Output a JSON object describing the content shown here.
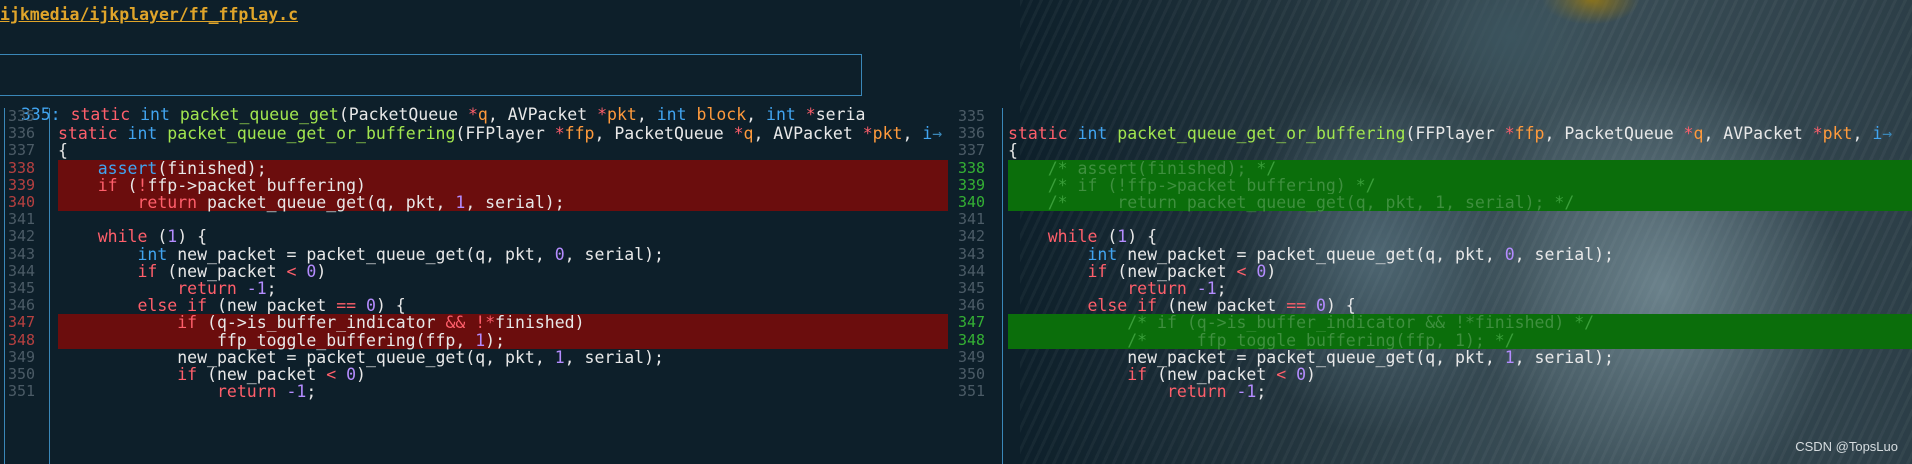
{
  "file_path": "ijkmedia/ijkplayer/ff_ffplay.c",
  "signature_line": {
    "number": "335:",
    "tokens": [
      {
        "t": " ",
        "c": ""
      },
      {
        "t": "static",
        "c": "kw"
      },
      {
        "t": " ",
        "c": ""
      },
      {
        "t": "int",
        "c": "ty"
      },
      {
        "t": " ",
        "c": ""
      },
      {
        "t": "packet_queue_get",
        "c": "fn"
      },
      {
        "t": "(PacketQueue ",
        "c": ""
      },
      {
        "t": "*",
        "c": "op"
      },
      {
        "t": "q",
        "c": "pm"
      },
      {
        "t": ", AVPacket ",
        "c": ""
      },
      {
        "t": "*",
        "c": "op"
      },
      {
        "t": "pkt",
        "c": "pm"
      },
      {
        "t": ", ",
        "c": ""
      },
      {
        "t": "int",
        "c": "ty"
      },
      {
        "t": " ",
        "c": ""
      },
      {
        "t": "block",
        "c": "pm"
      },
      {
        "t": ", ",
        "c": ""
      },
      {
        "t": "int",
        "c": "ty"
      },
      {
        "t": " ",
        "c": ""
      },
      {
        "t": "*",
        "c": "op"
      },
      {
        "t": "seria",
        "c": ""
      }
    ]
  },
  "left_lines": [
    {
      "n": "335",
      "mark": "",
      "tokens": []
    },
    {
      "n": "336",
      "mark": "",
      "tokens": [
        {
          "t": "static",
          "c": "kw"
        },
        {
          "t": " ",
          "c": ""
        },
        {
          "t": "int",
          "c": "ty"
        },
        {
          "t": " ",
          "c": ""
        },
        {
          "t": "packet_queue_get_or_buffering",
          "c": "fn"
        },
        {
          "t": "(FFPlayer ",
          "c": ""
        },
        {
          "t": "*",
          "c": "op"
        },
        {
          "t": "ffp",
          "c": "pm"
        },
        {
          "t": ", PacketQueue ",
          "c": ""
        },
        {
          "t": "*",
          "c": "op"
        },
        {
          "t": "q",
          "c": "pm"
        },
        {
          "t": ", AVPacket ",
          "c": ""
        },
        {
          "t": "*",
          "c": "op"
        },
        {
          "t": "pkt",
          "c": "pm"
        },
        {
          "t": ", ",
          "c": ""
        },
        {
          "t": "i",
          "c": "ty"
        },
        {
          "t": "→",
          "c": "trunc"
        }
      ]
    },
    {
      "n": "337",
      "mark": "",
      "tokens": [
        {
          "t": "{",
          "c": ""
        }
      ]
    },
    {
      "n": "338",
      "mark": "del",
      "tokens": [
        {
          "t": "    ",
          "c": ""
        },
        {
          "t": "assert",
          "c": "ty"
        },
        {
          "t": "(finished);",
          "c": ""
        }
      ]
    },
    {
      "n": "339",
      "mark": "del",
      "tokens": [
        {
          "t": "    ",
          "c": ""
        },
        {
          "t": "if",
          "c": "kw"
        },
        {
          "t": " (",
          "c": ""
        },
        {
          "t": "!",
          "c": "op"
        },
        {
          "t": "ffp->packet_buffering)",
          "c": ""
        }
      ]
    },
    {
      "n": "340",
      "mark": "del",
      "tokens": [
        {
          "t": "        ",
          "c": ""
        },
        {
          "t": "return",
          "c": "kw"
        },
        {
          "t": " packet_queue_get(q, pkt, ",
          "c": ""
        },
        {
          "t": "1",
          "c": "num"
        },
        {
          "t": ", serial);",
          "c": ""
        }
      ]
    },
    {
      "n": "341",
      "mark": "",
      "tokens": []
    },
    {
      "n": "342",
      "mark": "",
      "tokens": [
        {
          "t": "    ",
          "c": ""
        },
        {
          "t": "while",
          "c": "kw"
        },
        {
          "t": " (",
          "c": ""
        },
        {
          "t": "1",
          "c": "num"
        },
        {
          "t": ") {",
          "c": ""
        }
      ]
    },
    {
      "n": "343",
      "mark": "",
      "tokens": [
        {
          "t": "        ",
          "c": ""
        },
        {
          "t": "int",
          "c": "ty"
        },
        {
          "t": " new_packet = packet_queue_get(q, pkt, ",
          "c": ""
        },
        {
          "t": "0",
          "c": "num"
        },
        {
          "t": ", serial);",
          "c": ""
        }
      ]
    },
    {
      "n": "344",
      "mark": "",
      "tokens": [
        {
          "t": "        ",
          "c": ""
        },
        {
          "t": "if",
          "c": "kw"
        },
        {
          "t": " (new_packet ",
          "c": ""
        },
        {
          "t": "<",
          "c": "op"
        },
        {
          "t": " ",
          "c": ""
        },
        {
          "t": "0",
          "c": "num"
        },
        {
          "t": ")",
          "c": ""
        }
      ]
    },
    {
      "n": "345",
      "mark": "",
      "tokens": [
        {
          "t": "            ",
          "c": ""
        },
        {
          "t": "return",
          "c": "kw"
        },
        {
          "t": " ",
          "c": ""
        },
        {
          "t": "-1",
          "c": "num"
        },
        {
          "t": ";",
          "c": ""
        }
      ]
    },
    {
      "n": "346",
      "mark": "",
      "tokens": [
        {
          "t": "        ",
          "c": ""
        },
        {
          "t": "else",
          "c": "kw"
        },
        {
          "t": " ",
          "c": ""
        },
        {
          "t": "if",
          "c": "kw"
        },
        {
          "t": " (new_packet ",
          "c": ""
        },
        {
          "t": "==",
          "c": "op"
        },
        {
          "t": " ",
          "c": ""
        },
        {
          "t": "0",
          "c": "num"
        },
        {
          "t": ") {",
          "c": ""
        }
      ]
    },
    {
      "n": "347",
      "mark": "del",
      "tokens": [
        {
          "t": "            ",
          "c": ""
        },
        {
          "t": "if",
          "c": "kw"
        },
        {
          "t": " (q->is_buffer_indicator ",
          "c": ""
        },
        {
          "t": "&&",
          "c": "op"
        },
        {
          "t": " ",
          "c": ""
        },
        {
          "t": "!*",
          "c": "op"
        },
        {
          "t": "finished)",
          "c": ""
        }
      ]
    },
    {
      "n": "348",
      "mark": "del",
      "tokens": [
        {
          "t": "                ffp_toggle_buffering(ffp, ",
          "c": ""
        },
        {
          "t": "1",
          "c": "num"
        },
        {
          "t": ");",
          "c": ""
        }
      ]
    },
    {
      "n": "349",
      "mark": "",
      "tokens": [
        {
          "t": "            new_packet = packet_queue_get(q, pkt, ",
          "c": ""
        },
        {
          "t": "1",
          "c": "num"
        },
        {
          "t": ", serial);",
          "c": ""
        }
      ]
    },
    {
      "n": "350",
      "mark": "",
      "tokens": [
        {
          "t": "            ",
          "c": ""
        },
        {
          "t": "if",
          "c": "kw"
        },
        {
          "t": " (new_packet ",
          "c": ""
        },
        {
          "t": "<",
          "c": "op"
        },
        {
          "t": " ",
          "c": ""
        },
        {
          "t": "0",
          "c": "num"
        },
        {
          "t": ")",
          "c": ""
        }
      ]
    },
    {
      "n": "351",
      "mark": "",
      "tokens": [
        {
          "t": "                ",
          "c": ""
        },
        {
          "t": "return",
          "c": "kw"
        },
        {
          "t": " ",
          "c": ""
        },
        {
          "t": "-1",
          "c": "num"
        },
        {
          "t": ";",
          "c": ""
        }
      ]
    }
  ],
  "right_lines": [
    {
      "n": "335",
      "mark": "",
      "tokens": []
    },
    {
      "n": "336",
      "mark": "",
      "tokens": [
        {
          "t": "static",
          "c": "kw"
        },
        {
          "t": " ",
          "c": ""
        },
        {
          "t": "int",
          "c": "ty"
        },
        {
          "t": " ",
          "c": ""
        },
        {
          "t": "packet_queue_get_or_buffering",
          "c": "fn"
        },
        {
          "t": "(FFPlayer ",
          "c": ""
        },
        {
          "t": "*",
          "c": "op"
        },
        {
          "t": "ffp",
          "c": "pm"
        },
        {
          "t": ", PacketQueue ",
          "c": ""
        },
        {
          "t": "*",
          "c": "op"
        },
        {
          "t": "q",
          "c": "pm"
        },
        {
          "t": ", AVPacket ",
          "c": ""
        },
        {
          "t": "*",
          "c": "op"
        },
        {
          "t": "pkt",
          "c": "pm"
        },
        {
          "t": ", ",
          "c": ""
        },
        {
          "t": "i",
          "c": "ty"
        },
        {
          "t": "→",
          "c": "trunc"
        }
      ]
    },
    {
      "n": "337",
      "mark": "",
      "tokens": [
        {
          "t": "{",
          "c": ""
        }
      ]
    },
    {
      "n": "338",
      "mark": "add",
      "tokens": [
        {
          "t": "    ",
          "c": ""
        },
        {
          "t": "/*",
          "c": "cm"
        },
        {
          "t": " assert(finished); ",
          "c": "cm-txt"
        },
        {
          "t": "*/",
          "c": "cm"
        }
      ]
    },
    {
      "n": "339",
      "mark": "add",
      "tokens": [
        {
          "t": "    ",
          "c": ""
        },
        {
          "t": "/*",
          "c": "cm"
        },
        {
          "t": " if (!ffp->packet_buffering) ",
          "c": "cm-txt"
        },
        {
          "t": "*/",
          "c": "cm"
        }
      ]
    },
    {
      "n": "340",
      "mark": "add",
      "tokens": [
        {
          "t": "    ",
          "c": ""
        },
        {
          "t": "/*",
          "c": "cm"
        },
        {
          "t": "     return packet_queue_get(q, pkt, 1, serial); ",
          "c": "cm-txt"
        },
        {
          "t": "*/",
          "c": "cm"
        }
      ]
    },
    {
      "n": "341",
      "mark": "",
      "tokens": []
    },
    {
      "n": "342",
      "mark": "",
      "tokens": [
        {
          "t": "    ",
          "c": ""
        },
        {
          "t": "while",
          "c": "kw"
        },
        {
          "t": " (",
          "c": ""
        },
        {
          "t": "1",
          "c": "num"
        },
        {
          "t": ") {",
          "c": ""
        }
      ]
    },
    {
      "n": "343",
      "mark": "",
      "tokens": [
        {
          "t": "        ",
          "c": ""
        },
        {
          "t": "int",
          "c": "ty"
        },
        {
          "t": " new_packet = packet_queue_get(q, pkt, ",
          "c": ""
        },
        {
          "t": "0",
          "c": "num"
        },
        {
          "t": ", serial);",
          "c": ""
        }
      ]
    },
    {
      "n": "344",
      "mark": "",
      "tokens": [
        {
          "t": "        ",
          "c": ""
        },
        {
          "t": "if",
          "c": "kw"
        },
        {
          "t": " (new_packet ",
          "c": ""
        },
        {
          "t": "<",
          "c": "op"
        },
        {
          "t": " ",
          "c": ""
        },
        {
          "t": "0",
          "c": "num"
        },
        {
          "t": ")",
          "c": ""
        }
      ]
    },
    {
      "n": "345",
      "mark": "",
      "tokens": [
        {
          "t": "            ",
          "c": ""
        },
        {
          "t": "return",
          "c": "kw"
        },
        {
          "t": " ",
          "c": ""
        },
        {
          "t": "-1",
          "c": "num"
        },
        {
          "t": ";",
          "c": ""
        }
      ]
    },
    {
      "n": "346",
      "mark": "",
      "tokens": [
        {
          "t": "        ",
          "c": ""
        },
        {
          "t": "else",
          "c": "kw"
        },
        {
          "t": " ",
          "c": ""
        },
        {
          "t": "if",
          "c": "kw"
        },
        {
          "t": " (new_packet ",
          "c": ""
        },
        {
          "t": "==",
          "c": "op"
        },
        {
          "t": " ",
          "c": ""
        },
        {
          "t": "0",
          "c": "num"
        },
        {
          "t": ") {",
          "c": ""
        }
      ]
    },
    {
      "n": "347",
      "mark": "add",
      "tokens": [
        {
          "t": "            ",
          "c": ""
        },
        {
          "t": "/*",
          "c": "cm"
        },
        {
          "t": " if (q->is_buffer_indicator && !*finished) ",
          "c": "cm-txt"
        },
        {
          "t": "*/",
          "c": "cm"
        }
      ]
    },
    {
      "n": "348",
      "mark": "add",
      "tokens": [
        {
          "t": "            ",
          "c": ""
        },
        {
          "t": "/*",
          "c": "cm"
        },
        {
          "t": "     ffp_toggle_buffering(ffp, 1); ",
          "c": "cm-txt"
        },
        {
          "t": "*/",
          "c": "cm"
        }
      ]
    },
    {
      "n": "349",
      "mark": "",
      "tokens": [
        {
          "t": "            new_packet = packet_queue_get(q, pkt, ",
          "c": ""
        },
        {
          "t": "1",
          "c": "num"
        },
        {
          "t": ", serial);",
          "c": ""
        }
      ]
    },
    {
      "n": "350",
      "mark": "",
      "tokens": [
        {
          "t": "            ",
          "c": ""
        },
        {
          "t": "if",
          "c": "kw"
        },
        {
          "t": " (new_packet ",
          "c": ""
        },
        {
          "t": "<",
          "c": "op"
        },
        {
          "t": " ",
          "c": ""
        },
        {
          "t": "0",
          "c": "num"
        },
        {
          "t": ")",
          "c": ""
        }
      ]
    },
    {
      "n": "351",
      "mark": "",
      "tokens": [
        {
          "t": "                ",
          "c": ""
        },
        {
          "t": "return",
          "c": "kw"
        },
        {
          "t": " ",
          "c": ""
        },
        {
          "t": "-1",
          "c": "num"
        },
        {
          "t": ";",
          "c": ""
        }
      ]
    }
  ],
  "watermark": "CSDN @TopsLuo",
  "colors": {
    "deleted_bg": "#6b0d0d",
    "added_bg": "#0b6e0b",
    "border": "#3a87b8",
    "file_path": "#e0a52a"
  }
}
